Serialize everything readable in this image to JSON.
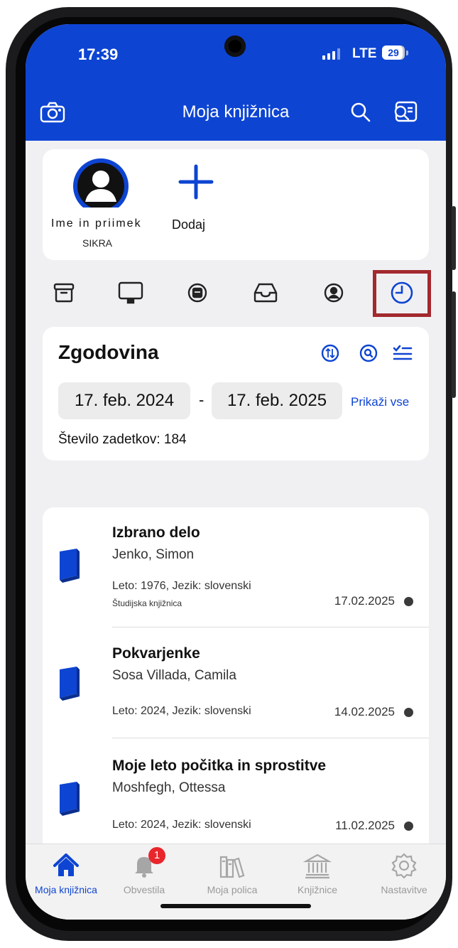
{
  "status": {
    "time": "17:39",
    "network": "LTE",
    "battery": "29"
  },
  "header": {
    "title": "Moja knjižnica",
    "left_icon": "camera-icon",
    "right_icons": [
      "search-icon",
      "card-search-icon"
    ]
  },
  "profile": {
    "name": "Ime in priimek",
    "system": "SIKRA",
    "add_label": "Dodaj"
  },
  "icon_bar": [
    "archive-icon",
    "monitor-icon",
    "reservation-icon",
    "inbox-icon",
    "profile-icon",
    "history-icon"
  ],
  "history": {
    "title": "Zgodovina",
    "date_from": "17. feb. 2024",
    "separator": "-",
    "date_to": "17. feb. 2025",
    "show_all": "Prikaži vse",
    "results_count": "Število zadetkov: 184"
  },
  "items": [
    {
      "title": "Izbrano delo",
      "author": "Jenko, Simon",
      "meta": "Leto: 1976, Jezik: slovenski",
      "library": "Študijska knjižnica",
      "date": "17.02.2025"
    },
    {
      "title": "Pokvarjenke",
      "author": "Sosa Villada, Camila",
      "meta": "Leto: 2024, Jezik: slovenski",
      "library": "",
      "date": "14.02.2025"
    },
    {
      "title": "Moje leto počitka in sprostitve",
      "author": "Moshfegh, Ottessa",
      "meta": "Leto: 2024, Jezik: slovenski",
      "library": "",
      "date": "11.02.2025"
    }
  ],
  "bottom_nav": [
    {
      "label": "Moja knjižnica",
      "icon": "home-icon",
      "active": true
    },
    {
      "label": "Obvestila",
      "icon": "bell-icon",
      "badge": "1"
    },
    {
      "label": "Moja polica",
      "icon": "shelf-icon"
    },
    {
      "label": "Knjižnice",
      "icon": "library-icon"
    },
    {
      "label": "Nastavitve",
      "icon": "settings-icon"
    }
  ],
  "colors": {
    "brand": "#0d44d2",
    "highlight": "#a3292f",
    "badge": "#e8262c"
  }
}
